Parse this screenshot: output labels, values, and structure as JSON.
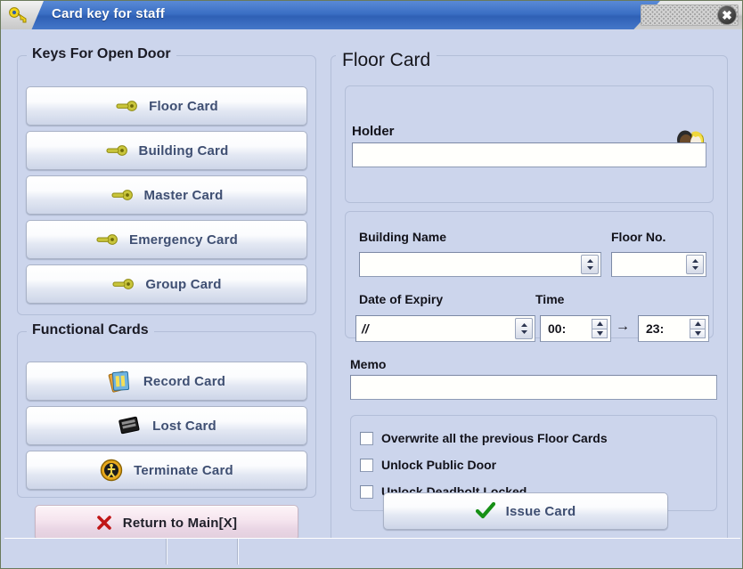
{
  "window": {
    "title": "Card key for staff",
    "title_icon": "key-icon",
    "close_label": "✖"
  },
  "left_panel": {
    "keys_group": {
      "title": "Keys For Open Door",
      "buttons": [
        {
          "label": "Floor Card",
          "icon": "key-icon"
        },
        {
          "label": "Building Card",
          "icon": "key-icon"
        },
        {
          "label": "Master Card",
          "icon": "key-icon"
        },
        {
          "label": "Emergency Card",
          "icon": "key-icon"
        },
        {
          "label": "Group Card",
          "icon": "key-icon"
        }
      ]
    },
    "functional_group": {
      "title": "Functional Cards",
      "buttons": [
        {
          "label": "Record Card",
          "icon": "cards-stack-icon"
        },
        {
          "label": "Lost Card",
          "icon": "black-card-icon"
        },
        {
          "label": "Terminate Card",
          "icon": "pedestrian-circle-icon"
        }
      ]
    },
    "return_button": {
      "label": "Return to Main[X]",
      "icon": "red-x-icon"
    }
  },
  "right_panel": {
    "title": "Floor Card",
    "holder": {
      "label": "Holder",
      "value": "",
      "icon": "people-key-icon"
    },
    "building_name": {
      "label": "Building Name",
      "value": ""
    },
    "floor_no": {
      "label": "Floor No.",
      "value": ""
    },
    "date_of_expiry": {
      "label": "Date of Expiry",
      "value": "//"
    },
    "time": {
      "label": "Time",
      "from": "00:",
      "to": "23:",
      "separator": "→"
    },
    "memo": {
      "label": "Memo",
      "value": ""
    },
    "options": [
      {
        "label": "Overwrite all the previous Floor Cards",
        "checked": false
      },
      {
        "label": "Unlock Public Door",
        "checked": false
      },
      {
        "label": "Unlock Deadbolt Locked",
        "checked": false
      }
    ],
    "issue_button": {
      "label": "Issue Card",
      "icon": "green-check-icon"
    }
  },
  "statusbar": {
    "panels": [
      "",
      "",
      ""
    ]
  },
  "colors": {
    "background": "#ccd5ec",
    "title_bar_blue": "#3a6fc4",
    "button_text": "#3f4f72",
    "label_text": "#12121a",
    "key_icon": "#c8c43c",
    "accent_green": "#169016",
    "accent_red": "#c01616"
  }
}
